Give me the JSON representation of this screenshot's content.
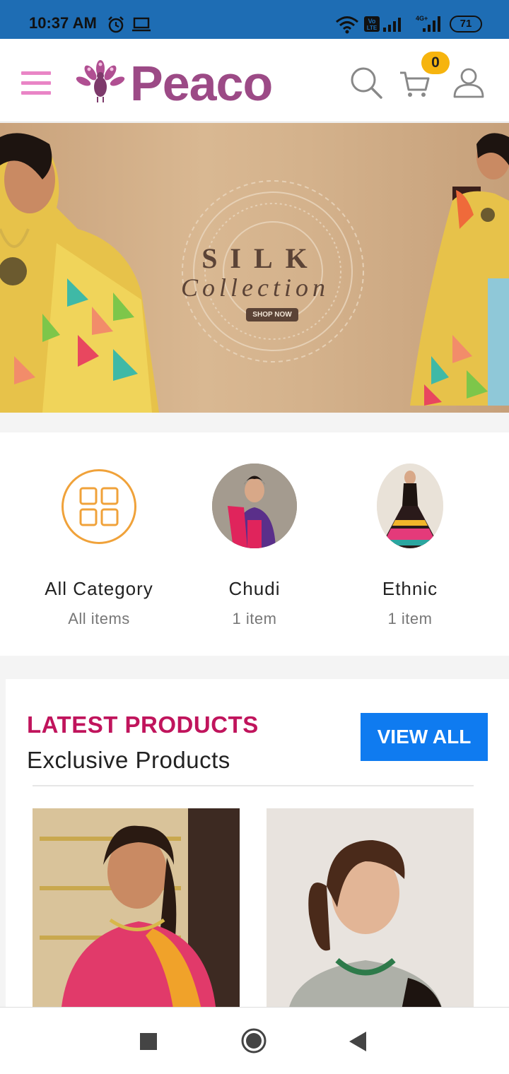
{
  "status_bar": {
    "time": "10:37 AM",
    "battery": "71",
    "icons": [
      "alarm-icon",
      "laptop-icon",
      "wifi-icon",
      "volte-icon",
      "signal-icon",
      "signal-4g-icon",
      "battery-icon"
    ]
  },
  "header": {
    "logo_text": "Peaco",
    "cart_count": "0",
    "icons": [
      "menu-icon",
      "peacock-logo-icon",
      "search-icon",
      "cart-icon",
      "user-icon"
    ]
  },
  "banner": {
    "title": "SILK",
    "subtitle": "Collection",
    "cta": "SHOP NOW"
  },
  "categories": [
    {
      "name": "All Category",
      "count": "All items"
    },
    {
      "name": "Chudi",
      "count": "1 item"
    },
    {
      "name": "Ethnic",
      "count": "1 item"
    }
  ],
  "latest": {
    "title": "LATEST PRODUCTS",
    "subtitle": "Exclusive Products",
    "view_all": "VIEW ALL"
  },
  "colors": {
    "status_bar": "#1e6db4",
    "accent_pink": "#e24eb0",
    "latest_title": "#c0145c",
    "view_all_button": "#0f7bf0",
    "cart_badge": "#f6b40e",
    "category_icon": "#f0a23a"
  }
}
